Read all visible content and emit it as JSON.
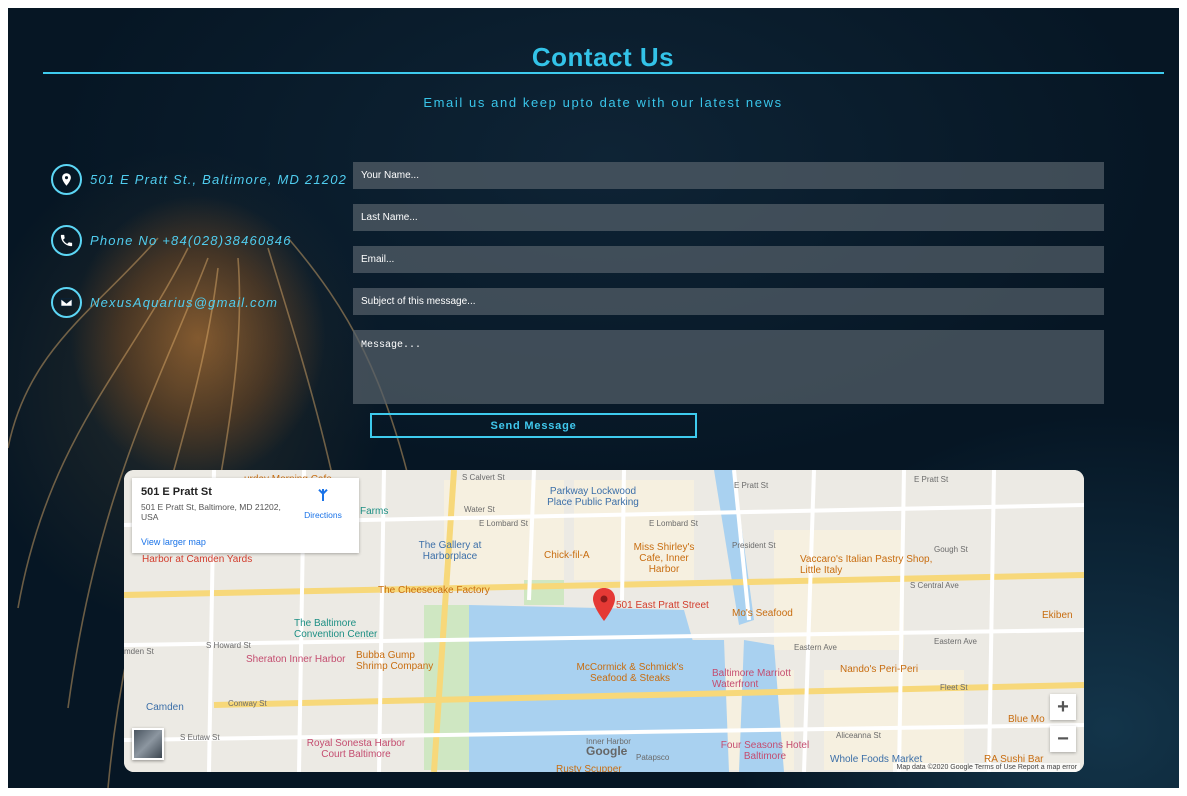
{
  "header": {
    "title": "Contact Us",
    "subtitle": "Email us and keep upto date with our latest news"
  },
  "contact": {
    "address": "501 E Pratt St., Baltimore, MD 21202",
    "phone": "Phone No +84(028)38460846",
    "email": "NexusAquarius@gmail.com"
  },
  "form": {
    "name_placeholder": "Your Name...",
    "lastname_placeholder": "Last Name...",
    "email_placeholder": "Email...",
    "subject_placeholder": "Subject of this message...",
    "message_placeholder": "Message...",
    "send_label": "Send Message"
  },
  "map": {
    "card": {
      "title": "501 E Pratt St",
      "address": "501 E Pratt St, Baltimore, MD 21202, USA",
      "directions": "Directions",
      "larger_map": "View larger map"
    },
    "marker_label": "501 East Pratt Street",
    "places": {
      "saturday_cafe": "urday Morning Cafe",
      "parkway": "Parkway Lockwood Place Public Parking",
      "farms": "Farms",
      "gallery": "The Gallery at Harborplace",
      "chick": "Chick-fil-A",
      "miss_shirleys": "Miss Shirley's Cafe, Inner Harbor",
      "vaccaros": "Vaccaro's Italian Pastry Shop, Little Italy",
      "camden_yards": "Harbor at Camden Yards",
      "cheesecake": "The Cheesecake Factory",
      "mos": "Mo's Seafood",
      "ekiben": "Ekiben",
      "convention": "The Baltimore Convention Center",
      "sheraton": "Sheraton Inner Harbor",
      "bubba": "Bubba Gump Shrimp Company",
      "mccormick": "McCormick & Schmick's Seafood & Steaks",
      "marriott": "Baltimore Marriott Waterfront",
      "nandos": "Nando's Peri-Peri",
      "camden": "Camden",
      "royal": "Royal Sonesta Harbor Court Baltimore",
      "four_seasons": "Four Seasons Hotel Baltimore",
      "whole_foods": "Whole Foods Market",
      "blue_moon": "Blue Mo",
      "ra_sushi": "RA Sushi Bar",
      "rusty": "Rusty Scupper"
    },
    "streets": {
      "e_lombard": "E Lombard St",
      "e_lombard2": "E Lombard St",
      "e_pratt": "E Pratt St",
      "e_pratt2": "E Pratt St",
      "calvert": "S Calvert St",
      "water": "Water St",
      "president": "President St",
      "gough": "Gough St",
      "s_central": "S Central Ave",
      "eastern": "Eastern Ave",
      "eastern2": "Eastern Ave",
      "fleet": "Fleet St",
      "aliceanna": "Aliceanna St",
      "conway": "Conway St",
      "howard": "S Howard St",
      "eutaw": "S Eutaw St",
      "camden_st": "mden St",
      "inner_harbor": "Inner Harbor",
      "patapsco": "Patapsco"
    },
    "google": "Google",
    "attribution": "Map data ©2020 Google   Terms of Use   Report a map error",
    "zoom_in": "+",
    "zoom_out": "−"
  }
}
